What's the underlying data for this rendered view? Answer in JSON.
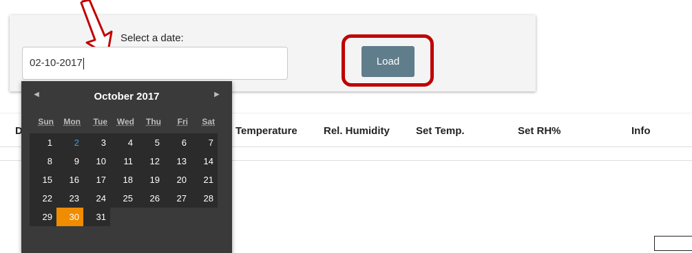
{
  "form": {
    "label": "Select a date:",
    "date_value": "02-10-2017",
    "load_label": "Load"
  },
  "table": {
    "headers": [
      "D",
      "Temperature",
      "Rel. Humidity",
      "Set Temp.",
      "Set RH%",
      "Info"
    ]
  },
  "datepicker": {
    "prev_icon": "◀",
    "next_icon": "▶",
    "month_title": "October 2017",
    "weekdays": [
      "Sun",
      "Mon",
      "Tue",
      "Wed",
      "Thu",
      "Fri",
      "Sat"
    ],
    "weeks": [
      [
        "1",
        "2",
        "3",
        "4",
        "5",
        "6",
        "7"
      ],
      [
        "8",
        "9",
        "10",
        "11",
        "12",
        "13",
        "14"
      ],
      [
        "15",
        "16",
        "17",
        "18",
        "19",
        "20",
        "21"
      ],
      [
        "22",
        "23",
        "24",
        "25",
        "26",
        "27",
        "28"
      ],
      [
        "29",
        "30",
        "31",
        "",
        "",
        "",
        ""
      ]
    ],
    "today_day": "2",
    "selected_day": "30"
  },
  "colors": {
    "load_button": "#607d8b",
    "highlight": "#c00000",
    "selected_day": "#f08c00",
    "today_day": "#33a0f0"
  }
}
